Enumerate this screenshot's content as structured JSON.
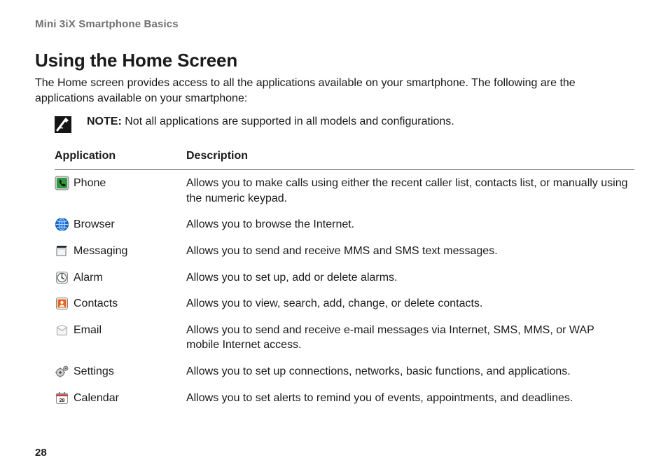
{
  "section_header": "Mini 3iX Smartphone Basics",
  "title": "Using the Home Screen",
  "intro": "The Home screen provides access to all the applications available on your smartphone. The following are the applications available on your smartphone:",
  "note_label": "NOTE:",
  "note_text": "Not all applications are supported in all models and configurations.",
  "table": {
    "col_app": "Application",
    "col_desc": "Description",
    "apps": [
      {
        "icon": "phone-app-icon",
        "name": "Phone",
        "desc": "Allows you to make calls using either the recent caller list, contacts list, or manually using the numeric keypad."
      },
      {
        "icon": "browser-app-icon",
        "name": "Browser",
        "desc": "Allows you to browse the Internet."
      },
      {
        "icon": "messaging-app-icon",
        "name": "Messaging",
        "desc": "Allows you to send and receive MMS and SMS text messages."
      },
      {
        "icon": "alarm-app-icon",
        "name": "Alarm",
        "desc": "Allows you to set up, add or delete alarms."
      },
      {
        "icon": "contacts-app-icon",
        "name": "Contacts",
        "desc": "Allows you to view, search, add, change, or delete contacts."
      },
      {
        "icon": "email-app-icon",
        "name": "Email",
        "desc": "Allows you to send and receive e-mail messages via Internet, SMS, MMS, or WAP mobile Internet access."
      },
      {
        "icon": "settings-app-icon",
        "name": "Settings",
        "desc": "Allows you to set up connections, networks, basic functions, and applications."
      },
      {
        "icon": "calendar-app-icon",
        "name": "Calendar",
        "desc": "Allows you to set alerts to remind you of events, appointments, and deadlines."
      }
    ]
  },
  "page_number": "28"
}
